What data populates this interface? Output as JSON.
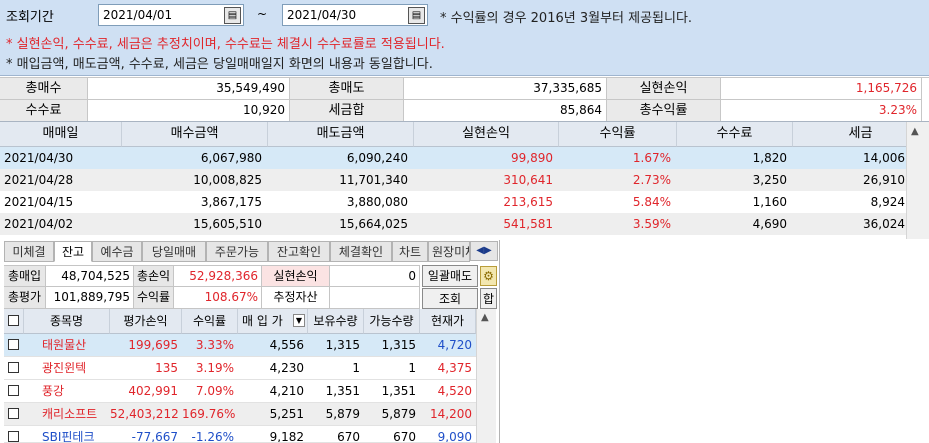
{
  "filter": {
    "period_label": "조회기간",
    "start_date": "2021/04/01",
    "tilde": "~",
    "end_date": "2021/04/30",
    "note1": "* 수익률의 경우 2016년 3월부터 제공됩니다.",
    "note2": "* 실현손익, 수수료, 세금은 추정치이며, 수수료는 체결시 수수료률로 적용됩니다.",
    "note3": "* 매입금액, 매도금액, 수수료, 세금은 당일매매일지 화면의 내용과 동일합니다."
  },
  "summary": {
    "total_buy_label": "총매수",
    "total_buy": "35,549,490",
    "total_sell_label": "총매도",
    "total_sell": "37,335,685",
    "realized_label": "실현손익",
    "realized": "1,165,726",
    "fee_label": "수수료",
    "fee": "10,920",
    "tax_label": "세금합",
    "tax": "85,864",
    "return_label": "총수익률",
    "return": "3.23%"
  },
  "daily": {
    "headers": [
      "매매일",
      "매수금액",
      "매도금액",
      "실현손익",
      "수익률",
      "수수료",
      "세금"
    ],
    "rows": [
      [
        "2021/04/30",
        "6,067,980",
        "6,090,240",
        "99,890",
        "1.67%",
        "1,820",
        "14,006"
      ],
      [
        "2021/04/28",
        "10,008,825",
        "11,701,340",
        "310,641",
        "2.73%",
        "3,250",
        "26,910"
      ],
      [
        "2021/04/15",
        "3,867,175",
        "3,880,080",
        "213,615",
        "5.84%",
        "1,160",
        "8,924"
      ],
      [
        "2021/04/02",
        "15,605,510",
        "15,664,025",
        "541,581",
        "3.59%",
        "4,690",
        "36,024"
      ]
    ]
  },
  "tabs": [
    "미체결",
    "잔고",
    "예수금",
    "당일매매",
    "주문가능",
    "잔고확인",
    "체결확인",
    "차트",
    "원장미체결"
  ],
  "active_tab": "잔고",
  "balance": {
    "total_buy_label": "총매입",
    "total_buy": "48,704,525",
    "total_pnl_label": "총손익",
    "total_pnl": "52,928,366",
    "realized_label": "실현손익",
    "realized": "0",
    "bulk_sell_label": "일괄매도",
    "total_eval_label": "총평가",
    "total_eval": "101,889,795",
    "return_label": "수익률",
    "return": "108.67%",
    "est_asset_label": "추정자산",
    "est_asset": "",
    "query_label": "조회",
    "sum_label": "합"
  },
  "holdings": {
    "headers": [
      "종목명",
      "평가손익",
      "수익률",
      "매 입 가",
      "보유수량",
      "가능수량",
      "현재가"
    ],
    "rows": [
      [
        "태원물산",
        "199,695",
        "3.33%",
        "4,556",
        "1,315",
        "1,315",
        "4,720"
      ],
      [
        "광진윈텍",
        "135",
        "3.19%",
        "4,230",
        "1",
        "1",
        "4,375"
      ],
      [
        "풍강",
        "402,991",
        "7.09%",
        "4,210",
        "1,351",
        "1,351",
        "4,520"
      ],
      [
        "캐리소프트",
        "52,403,212",
        "169.76%",
        "5,251",
        "5,879",
        "5,879",
        "14,200"
      ],
      [
        "SBI핀테크",
        "-77,667",
        "-1.26%",
        "9,182",
        "670",
        "670",
        "9,090"
      ]
    ]
  },
  "colors": {
    "positive": "#e0252b",
    "negative": "#1f4fc8",
    "header_bg": "#e3e9f1",
    "selected_row": "#d6e9f7"
  }
}
